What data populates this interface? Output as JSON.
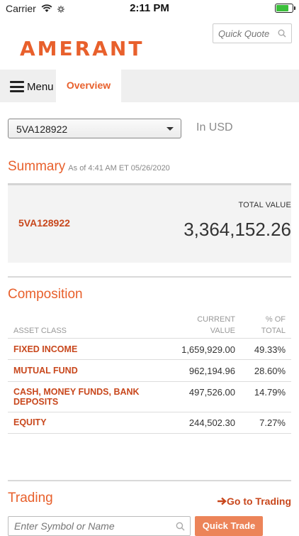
{
  "status_bar": {
    "carrier": "Carrier",
    "time": "2:11 PM"
  },
  "brand": {
    "logo_text": "AMERANT",
    "color": "#e8602c"
  },
  "quick_quote": {
    "placeholder": "Quick Quote"
  },
  "nav": {
    "menu_label": "Menu",
    "active_tab": "Overview"
  },
  "account_selector": {
    "selected": "5VA128922"
  },
  "currency_label": "In USD",
  "summary": {
    "title": "Summary",
    "as_of": "As of 4:41 AM ET 05/26/2020",
    "account": "5VA128922",
    "total_value_label": "TOTAL VALUE",
    "total_value": "3,364,152.26"
  },
  "composition": {
    "title": "Composition",
    "headers": {
      "asset_class": "ASSET CLASS",
      "current_value_line1": "CURRENT",
      "current_value_line2": "VALUE",
      "pct_line1": "% OF",
      "pct_line2": "TOTAL"
    },
    "rows": [
      {
        "name": "FIXED INCOME",
        "value": "1,659,929.00",
        "pct": "49.33%"
      },
      {
        "name": "MUTUAL FUND",
        "value": "962,194.96",
        "pct": "28.60%"
      },
      {
        "name": "CASH, MONEY FUNDS, BANK DEPOSITS",
        "value": "497,526.00",
        "pct": "14.79%"
      },
      {
        "name": "EQUITY",
        "value": "244,502.30",
        "pct": "7.27%"
      }
    ]
  },
  "trading": {
    "title": "Trading",
    "go_link": "Go to Trading",
    "symbol_placeholder": "Enter Symbol or Name",
    "quick_trade": "Quick Trade"
  }
}
